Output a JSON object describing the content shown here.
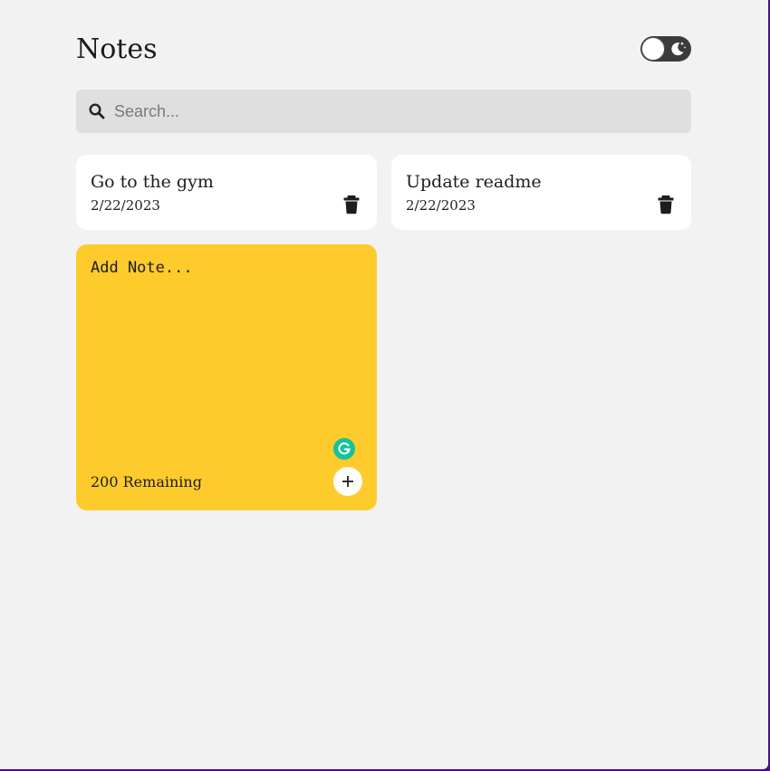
{
  "app": {
    "title": "Notes"
  },
  "theme_toggle": {
    "icon": "moon-icon",
    "colors": {
      "track": "#3b3b3b",
      "knob": "#ffffff"
    }
  },
  "search": {
    "placeholder": "Search...",
    "value": "",
    "icon": "search-icon"
  },
  "notes": [
    {
      "text": "Go to the gym",
      "date": "2/22/2023",
      "delete_icon": "trash-icon"
    },
    {
      "text": "Update readme",
      "date": "2/22/2023",
      "delete_icon": "trash-icon"
    }
  ],
  "new_note": {
    "placeholder": "Add Note...",
    "value": "",
    "remaining": "200 Remaining",
    "save_icon": "plus-icon",
    "extension_icon": "grammarly-icon",
    "color": "#fecb2d"
  },
  "colors": {
    "background": "#f2f2f2",
    "card": "#ffffff",
    "search_bg": "#dfdfdf",
    "accent_note": "#fecb2d",
    "grammarly": "#15c39a"
  }
}
